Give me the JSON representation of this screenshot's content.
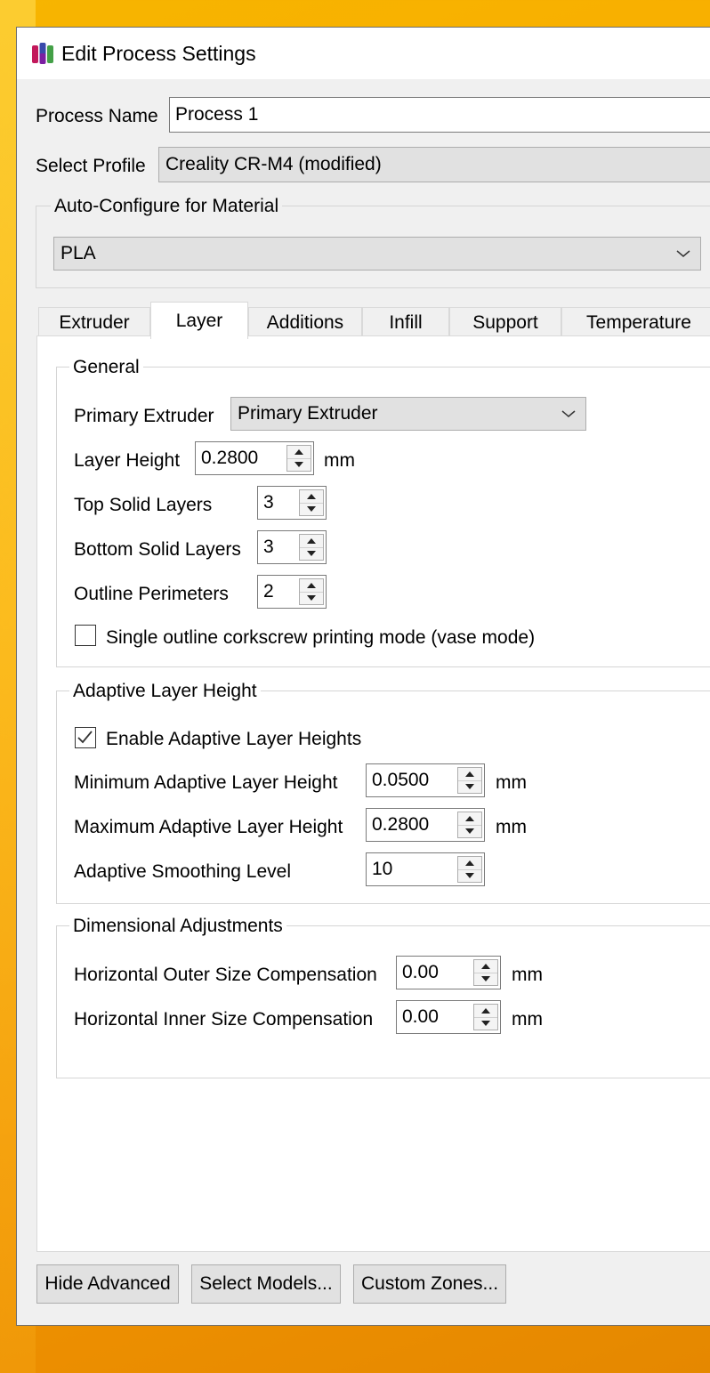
{
  "window": {
    "title": "Edit Process Settings"
  },
  "process_name": {
    "label": "Process Name",
    "value": "Process 1"
  },
  "select_profile": {
    "label": "Select Profile",
    "value": "Creality CR-M4 (modified)"
  },
  "auto_configure": {
    "title": "Auto-Configure for Material",
    "material": "PLA"
  },
  "tabs": [
    {
      "label": "Extruder"
    },
    {
      "label": "Layer",
      "active": true
    },
    {
      "label": "Additions"
    },
    {
      "label": "Infill"
    },
    {
      "label": "Support"
    },
    {
      "label": "Temperature"
    }
  ],
  "general": {
    "title": "General",
    "primary_extruder_label": "Primary Extruder",
    "primary_extruder_value": "Primary Extruder",
    "layer_height_label": "Layer Height",
    "layer_height_value": "0.2800",
    "layer_height_unit": "mm",
    "top_solid_label": "Top Solid Layers",
    "top_solid_value": "3",
    "bottom_solid_label": "Bottom Solid Layers",
    "bottom_solid_value": "3",
    "outline_label": "Outline Perimeters",
    "outline_value": "2",
    "vase_mode_label": "Single outline corkscrew printing mode (vase mode)",
    "vase_mode_checked": false
  },
  "adaptive": {
    "title": "Adaptive Layer Height",
    "enable_label": "Enable Adaptive Layer Heights",
    "enable_checked": true,
    "min_label": "Minimum Adaptive Layer Height",
    "min_value": "0.0500",
    "min_unit": "mm",
    "max_label": "Maximum Adaptive Layer Height",
    "max_value": "0.2800",
    "max_unit": "mm",
    "smoothing_label": "Adaptive Smoothing Level",
    "smoothing_value": "10"
  },
  "dimensional": {
    "title": "Dimensional Adjustments",
    "outer_label": "Horizontal Outer Size Compensation",
    "outer_value": "0.00",
    "outer_unit": "mm",
    "inner_label": "Horizontal Inner Size Compensation",
    "inner_value": "0.00",
    "inner_unit": "mm"
  },
  "buttons": {
    "hide_advanced": "Hide Advanced",
    "select_models": "Select Models...",
    "custom_zones": "Custom Zones..."
  }
}
